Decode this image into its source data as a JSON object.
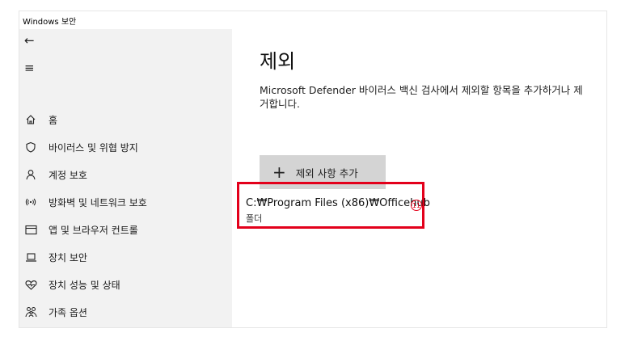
{
  "window": {
    "title": "Windows 보안"
  },
  "sidebar": {
    "back_icon": "←",
    "menu_icon": "≡",
    "items": [
      {
        "label": "홈",
        "icon": "home-icon"
      },
      {
        "label": "바이러스 및 위협 방지",
        "icon": "shield-icon"
      },
      {
        "label": "계정 보호",
        "icon": "person-icon"
      },
      {
        "label": "방화벽 및 네트워크 보호",
        "icon": "wifi-antenna-icon"
      },
      {
        "label": "앱 및 브라우저 컨트롤",
        "icon": "app-window-icon"
      },
      {
        "label": "장치 보안",
        "icon": "laptop-icon"
      },
      {
        "label": "장치 성능 및 상태",
        "icon": "heart-icon"
      },
      {
        "label": "가족 옵션",
        "icon": "family-icon"
      }
    ]
  },
  "main": {
    "title": "제외",
    "description": "Microsoft Defender 바이러스 백신 검사에서 제외할 항목을 추가하거나 제거합니다.",
    "add_button": {
      "plus": "+",
      "label": "제외 사항 추가"
    },
    "exclusion": {
      "path": "C:₩Program Files (x86)₩Officehub",
      "type": "폴더"
    },
    "annotation_badge": "11"
  },
  "colors": {
    "highlight": "#e3001b",
    "sidebar_bg": "#f2f2f2",
    "button_bg": "#d4d4d4"
  }
}
